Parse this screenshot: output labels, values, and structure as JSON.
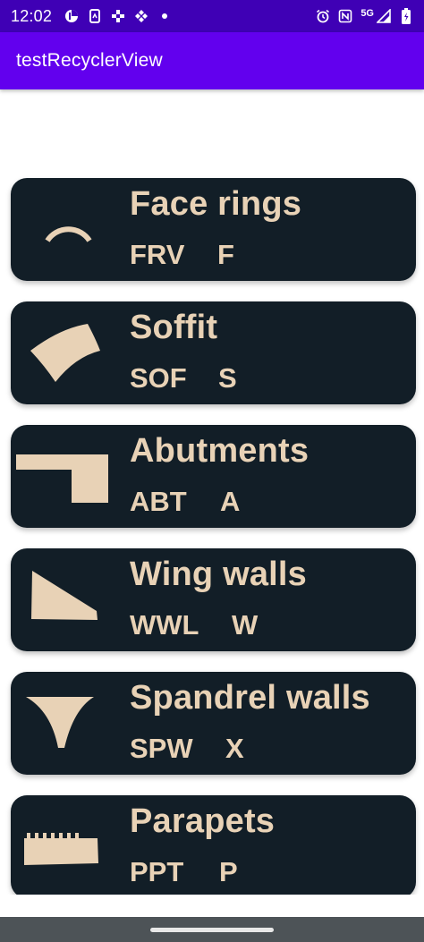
{
  "status_bar": {
    "time": "12:02",
    "network": "5G",
    "left_icons": [
      "pie-icon",
      "phone-sync-icon",
      "pinwheel-icon",
      "binance-icon",
      "dot-icon"
    ],
    "right_icons": [
      "alarm-icon",
      "nfc-icon",
      "signal-icon",
      "battery-icon"
    ]
  },
  "app_bar": {
    "title": "testRecyclerView"
  },
  "items": [
    {
      "title": "Face rings",
      "code": "FRV",
      "letter": "F",
      "icon": "face-ring-icon"
    },
    {
      "title": "Soffit",
      "code": "SOF",
      "letter": "S",
      "icon": "soffit-icon"
    },
    {
      "title": "Abutments",
      "code": "ABT",
      "letter": "A",
      "icon": "abutment-icon"
    },
    {
      "title": "Wing walls",
      "code": "WWL",
      "letter": "W",
      "icon": "wing-wall-icon"
    },
    {
      "title": "Spandrel walls",
      "code": "SPW",
      "letter": "X",
      "icon": "spandrel-wall-icon"
    },
    {
      "title": "Parapets",
      "code": "PPT",
      "letter": "P",
      "icon": "parapet-icon"
    }
  ],
  "colors": {
    "status_bar": "#3f00b5",
    "app_bar": "#6200ee",
    "card_background": "#121e27",
    "card_text": "#e8d2b6",
    "nav_bar": "#4d5357"
  }
}
